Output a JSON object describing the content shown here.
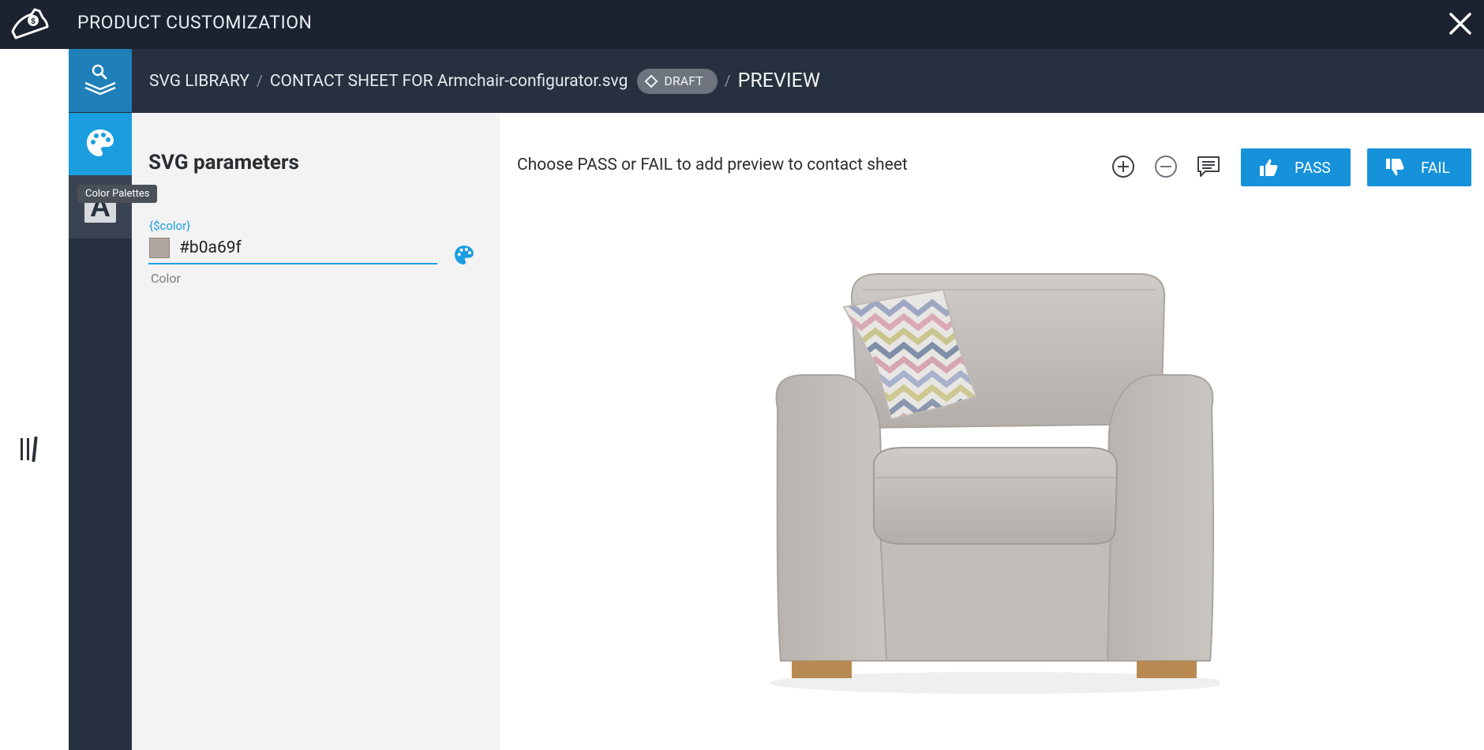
{
  "header": {
    "title": "PRODUCT CUSTOMIZATION"
  },
  "breadcrumb": {
    "items": [
      "SVG LIBRARY",
      "CONTACT SHEET FOR Armchair-configurator.svg"
    ],
    "separator": "/",
    "badge": "DRAFT",
    "current": "PREVIEW"
  },
  "rail": {
    "tooltip": "Color Palettes",
    "text_tool_glyph": "A"
  },
  "params": {
    "title": "SVG parameters",
    "variable": "{$color}",
    "value": "#b0a69f",
    "field_label": "Color"
  },
  "main": {
    "instruction": "Choose PASS or FAIL to add preview to contact sheet",
    "pass_label": "PASS",
    "fail_label": "FAIL"
  },
  "colors": {
    "accent": "#1a9ee0",
    "topbar": "#1b2230",
    "rail": "#27303e",
    "swatch": "#b0a69f"
  },
  "icons": [
    "logo-icon",
    "close-icon",
    "layers-icon",
    "palette-icon",
    "text-icon",
    "panel-handle-icon",
    "zoom-in-icon",
    "zoom-out-icon",
    "comment-icon",
    "thumbs-up-icon",
    "thumbs-down-icon"
  ]
}
